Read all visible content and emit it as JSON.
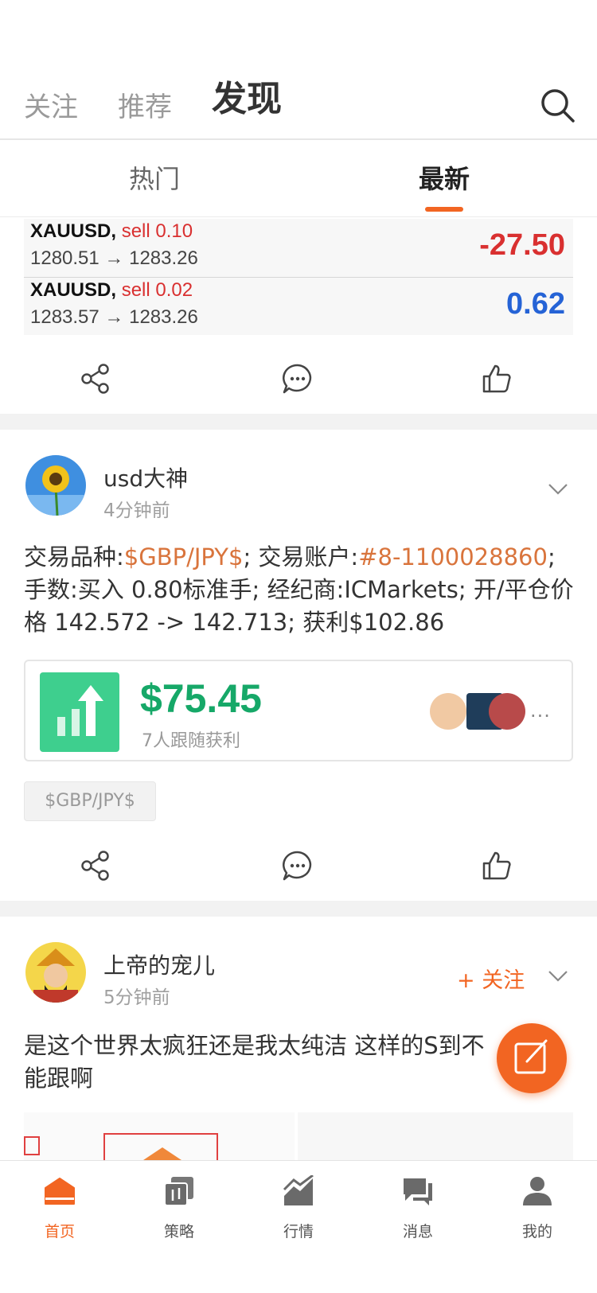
{
  "top_nav": {
    "tabs": [
      "关注",
      "推荐",
      "发现"
    ],
    "active": "发现"
  },
  "sub_tabs": {
    "items": [
      "热门",
      "最新"
    ],
    "active": "最新"
  },
  "accent_color": "#f26522",
  "trades": [
    {
      "symbol": "XAUUSD,",
      "side": "sell 0.10",
      "price": "1280.51 → 1283.26",
      "pnl": "-27.50",
      "pnl_color": "#d93030"
    },
    {
      "symbol": "XAUUSD,",
      "side": "sell 0.02",
      "price": "1283.57 → 1283.26",
      "pnl": "0.62",
      "pnl_color": "#2563d6"
    }
  ],
  "post1": {
    "username": "usd大神",
    "time": "4分钟前",
    "text": {
      "p1": "交易品种:",
      "symbol": "$GBP/JPY$",
      "p2": "; 交易账户:",
      "account": "#8-1100028860",
      "p3": "; 手数:买入 0.80标准手; 经纪商:ICMarkets; 开/平仓价格 142.572 -> 142.713; 获利$102.86"
    },
    "follow_card": {
      "amount": "$75.45",
      "subtitle": "7人跟随获利",
      "more": "..."
    },
    "tag": "$GBP/JPY$"
  },
  "post2": {
    "username": "上帝的宠儿",
    "time": "5分钟前",
    "follow_label": "+ 关注",
    "text": "是这个世界太疯狂还是我太纯洁 这样的S到不能跟啊"
  },
  "bottom_nav": [
    {
      "label": "首页",
      "icon": "home-icon"
    },
    {
      "label": "策略",
      "icon": "strategy-icon"
    },
    {
      "label": "行情",
      "icon": "chart-icon"
    },
    {
      "label": "消息",
      "icon": "message-icon"
    },
    {
      "label": "我的",
      "icon": "profile-icon"
    }
  ],
  "bottom_nav_active": "首页"
}
